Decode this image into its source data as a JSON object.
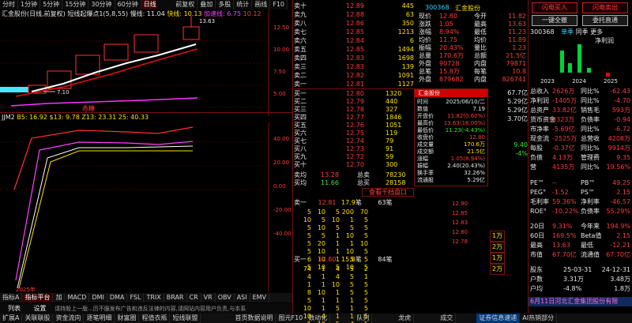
{
  "top_toolbar": {
    "items": [
      "分时",
      "1分钟",
      "5分钟",
      "15分钟",
      "30分钟",
      "60分钟",
      "日线",
      "周线",
      "月线",
      "多周",
      "更多"
    ],
    "active_index": 6,
    "right": [
      "前复权",
      "叠加",
      "多股",
      "统计",
      "画线",
      "F10",
      "标记",
      "−"
    ]
  },
  "chart": {
    "title": "汇金股份(日线,前复权)",
    "indicator": "短线起爆点1(5,8,55)",
    "leg1": "慢线: 11.04",
    "leg2": "快线: 10.13",
    "leg3": "加速线: 6.75",
    "leg4": "10.12",
    "high_label": "13.63",
    "low_label": "7.10",
    "band_label": "赤糖",
    "y_labels": [
      "12.50",
      "10.00",
      "7.50",
      "5.00",
      "2.50"
    ],
    "sub_title": "JJM2",
    "sub_vals": "B5: 16.92  $13: 9.78  Z13: 23.31  25: 40.33",
    "sub_y": [
      "40.00",
      "20.00",
      "0.00",
      "-20.00",
      "-40.00",
      "-60.00"
    ],
    "year_label": "2025年"
  },
  "bottom_tabs": [
    "指标A",
    "指标平台",
    "加",
    "MACD",
    "DMI",
    "DMA",
    "FSL",
    "TRIX",
    "BRAR",
    "CR",
    "VR",
    "OBV",
    "ASI",
    "EMV",
    "∨"
  ],
  "bottom_bar2": [
    "列表",
    "设置"
  ],
  "notice": "请持股上一版...历不服发布广告和违反法律的内容,请网站内容用户负责,与本系",
  "status_items": [
    "扩展A",
    "关联联股",
    "资金流向",
    "逐笔明细",
    "财富圈",
    "程值衣瓶",
    "短线联盟",
    "首页数据说明",
    "图元F10",
    "数动化",
    "扫",
    "队列",
    "龙虎",
    "成交",
    "证券信息速递",
    "AI热销部分"
  ],
  "order_book": {
    "sells": [
      {
        "label": "卖十",
        "price": "12.89",
        "vol": "445"
      },
      {
        "label": "卖九",
        "price": "12.88",
        "vol": "63"
      },
      {
        "label": "卖八",
        "price": "12.86",
        "vol": "350"
      },
      {
        "label": "卖七",
        "price": "12.85",
        "vol": "1213"
      },
      {
        "label": "卖六",
        "price": "12.84",
        "vol": "6"
      },
      {
        "label": "卖五",
        "price": "12.85",
        "vol": "1494"
      },
      {
        "label": "卖四",
        "price": "12.83",
        "vol": "1698"
      },
      {
        "label": "卖三",
        "price": "12.83",
        "vol": "139"
      },
      {
        "label": "卖二",
        "price": "12.82",
        "vol": "1091"
      },
      {
        "label": "卖一",
        "price": "12.81",
        "vol": "1127"
      }
    ],
    "buys": [
      {
        "label": "买一",
        "price": "12.80",
        "vol": "1320"
      },
      {
        "label": "买二",
        "price": "12.79",
        "vol": "440"
      },
      {
        "label": "买三",
        "price": "12.78",
        "vol": "327"
      },
      {
        "label": "买四",
        "price": "12.77",
        "vol": "1846"
      },
      {
        "label": "买五",
        "price": "12.76",
        "vol": "1051"
      },
      {
        "label": "买六",
        "price": "12.75",
        "vol": "119"
      },
      {
        "label": "买七",
        "price": "12.74",
        "vol": "79"
      },
      {
        "label": "买八",
        "price": "12.73",
        "vol": "91"
      },
      {
        "label": "买九",
        "price": "12.72",
        "vol": "59"
      },
      {
        "label": "买十",
        "price": "12.70",
        "vol": "300"
      }
    ],
    "avg_sell_label": "卖均",
    "avg_sell": "13.28",
    "total_sell_label": "总卖",
    "total_sell": "78230",
    "avg_buy_label": "买均",
    "avg_buy": "11.66",
    "total_buy_label": "总买",
    "total_buy": "28158",
    "thousand_btn": "查看千档盘口"
  },
  "quote": {
    "code": "300368",
    "name": "汇金股份",
    "items": [
      [
        "现价",
        "12.80",
        "今开",
        "11.82"
      ],
      [
        "涨跌",
        "1.05",
        "最高",
        "13.63"
      ],
      [
        "涨幅",
        "8.94%",
        "最低",
        "11.23"
      ],
      [
        "均价",
        "11.75",
        "均价",
        "11.89"
      ],
      [
        "振幅",
        "20.43%",
        "量比",
        "1.23"
      ],
      [
        "总量",
        "170.6万",
        "总额",
        "21.5亿"
      ],
      [
        "外盘",
        "90728",
        "内盘",
        "79871"
      ],
      [
        "总笔",
        "15.8万",
        "每笔",
        "10.8"
      ],
      [
        "外盘",
        "879682",
        "内盘",
        "826741"
      ]
    ]
  },
  "tooltip": {
    "title": "汇金股份",
    "time_l": "时间",
    "time": "2025/06/10/二",
    "num_l": "数值",
    "num": "7.19",
    "open_l": "开盘价",
    "open": "11.82(0.60%)",
    "high_l": "最高价",
    "high": "13.63(16.00%)",
    "low_l": "最低价",
    "low": "11.23(-4.43%)",
    "close_l": "收盘价",
    "close": "12.80",
    "vol_l": "成交量",
    "vol": "170.6万",
    "amt_l": "成交额",
    "amt": "21.5亿",
    "chg_l": "涨幅",
    "chg": "1.05(8.94%)",
    "amp_l": "振幅",
    "amp": "2.40(20.43%)",
    "turn_l": "换手率",
    "turn": "32.26%",
    "flow_l": "流通股",
    "flow": "5.29亿"
  },
  "mini_right": [
    "67.7亿",
    "5.29亿",
    "5.29亿",
    "3.70亿",
    "9.40",
    "-4%"
  ],
  "detail": {
    "header": [
      "卖一",
      "12.81",
      "17.9",
      "笔",
      "63笔"
    ],
    "sell_grid": [
      [
        "5",
        "10",
        "5",
        "200",
        "70"
      ],
      [
        "10",
        "5",
        "10",
        "1",
        "5"
      ],
      [
        "5",
        "10",
        "5",
        "5",
        "5"
      ],
      [
        "5",
        "5",
        "1",
        "10",
        "5"
      ],
      [
        "5",
        "20",
        "1",
        "1",
        "10"
      ],
      [
        "5",
        "10",
        "1",
        "10",
        "5"
      ],
      [
        "6",
        "10",
        "1",
        "5",
        "5"
      ],
      [
        "5",
        "10",
        "5",
        "10",
        "5"
      ]
    ],
    "header2": [
      "买一",
      "12.80",
      "15.8",
      "笔",
      "84笔"
    ],
    "buy_grid": [
      [
        "74",
        "1",
        "4",
        "5",
        "2"
      ],
      [
        "4",
        "1",
        "4",
        "5",
        "1"
      ],
      [
        "1",
        "1",
        "10",
        "5",
        "5"
      ],
      [
        "8",
        "10",
        "1",
        "5",
        "5"
      ],
      [
        "5",
        "1",
        "1",
        "1",
        "5"
      ],
      [
        "10",
        "1",
        "5",
        "1",
        "5"
      ],
      [
        "10",
        "4",
        "1",
        "1",
        "5"
      ],
      [
        "5",
        "10",
        "5",
        "4",
        "5"
      ]
    ]
  },
  "small_col": [
    "12.90",
    "12.85",
    "12.83",
    "12.80",
    "12.78"
  ],
  "side_mid": [
    "1万",
    "2万",
    "1万",
    "2万"
  ],
  "right_panel": {
    "buy_btn": "闪电买入",
    "sell_btn": "闪电卖出",
    "one_key": "一键全撤",
    "order_btn": "委托直通",
    "code": "300368",
    "tabs": [
      "单季",
      "同季",
      "更多"
    ],
    "net_profit": "净利润",
    "years": [
      "2023",
      "2024",
      "2025"
    ],
    "fin": [
      [
        "总收入",
        "2626万",
        "同比%",
        "-62.43"
      ],
      [
        "净利润",
        "-1405万",
        "同比%",
        "-4.70"
      ],
      [
        "总资产",
        "33.82亿",
        "销售毛",
        "593万"
      ],
      [
        "货币资金",
        "6323万",
        "负债率",
        "-0.94"
      ],
      [
        "市净率",
        "-5.69亿",
        "同比%",
        "-6.72"
      ],
      [
        "现金流",
        "-2525万",
        "总营收",
        "4208万"
      ],
      [
        "每股",
        "-0.37亿",
        "同比%",
        "9914万"
      ],
      [
        "负债",
        "4.13万",
        "管理费",
        "9.35"
      ],
      [
        "营",
        "4135万",
        "同比%",
        "19.56%"
      ]
    ],
    "ratios": [
      [
        "PE™",
        "--",
        "PB™",
        "49.25"
      ],
      [
        "PEG°",
        "-1.52",
        "PS™",
        "2.15"
      ],
      [
        "毛利率",
        "59.36%",
        "净利率",
        "-46.57"
      ],
      [
        "ROE°",
        "-10.22%",
        "负债率",
        "55.29%"
      ]
    ],
    "perf": [
      [
        "20日",
        "9.31%",
        "今年来",
        "194.9%"
      ],
      [
        "60日",
        "169.5%",
        "Beta值",
        "2.15"
      ],
      [
        "最高",
        "13.63",
        "最低",
        "-12.21"
      ],
      [
        "市值",
        "67.70亿",
        "流通值",
        "67.70亿"
      ]
    ],
    "dates": [
      [
        "股东",
        "25-03-31",
        "24-12-31"
      ],
      [
        "户数",
        "3.31万",
        "3.48万"
      ],
      [
        "户均",
        "-4.8%",
        "1.8万"
      ]
    ],
    "ticker": "6月11日河北汇金集团股份有限"
  }
}
